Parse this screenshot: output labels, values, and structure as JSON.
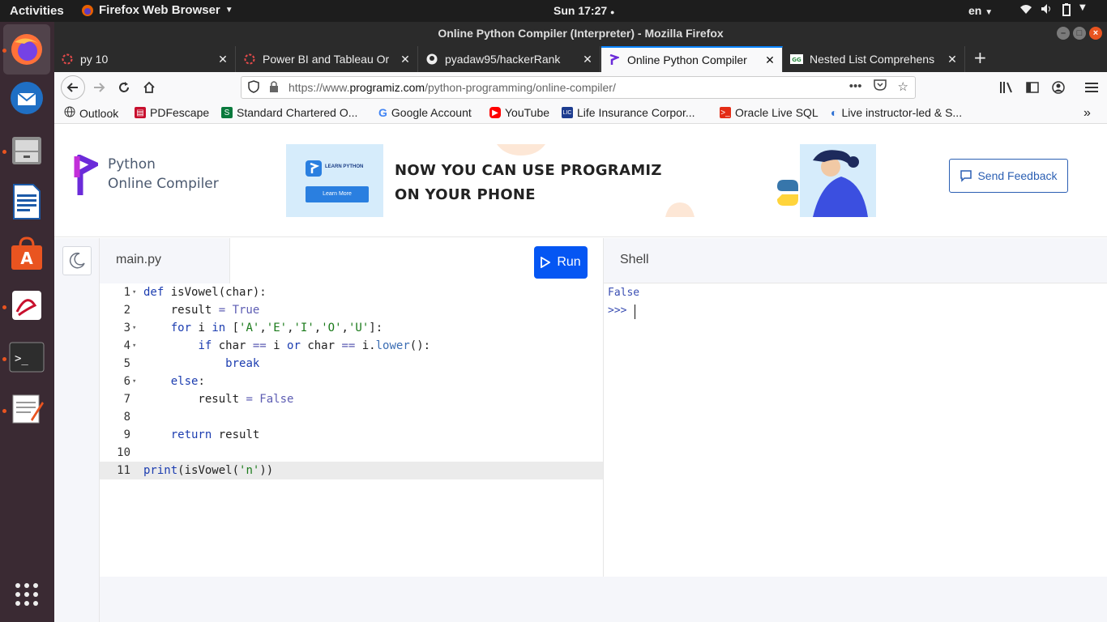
{
  "system": {
    "activities": "Activities",
    "app_name": "Firefox Web Browser",
    "clock": "Sun 17:27",
    "language": "en"
  },
  "window": {
    "title": "Online Python Compiler (Interpreter) - Mozilla Firefox"
  },
  "tabs": [
    {
      "label": "py 10"
    },
    {
      "label": "Power BI and Tableau Or"
    },
    {
      "label": "pyadaw95/hackerRank"
    },
    {
      "label": "Online Python Compiler"
    },
    {
      "label": "Nested List Comprehens"
    }
  ],
  "navbar": {
    "url_prefix": "https://www.",
    "url_domain": "programiz.com",
    "url_path": "/python-programming/online-compiler/"
  },
  "bookmarks": [
    {
      "label": "Outlook"
    },
    {
      "label": "PDFescape"
    },
    {
      "label": "Standard Chartered O..."
    },
    {
      "label": "Google Account"
    },
    {
      "label": "YouTube"
    },
    {
      "label": "Life Insurance Corpor..."
    },
    {
      "label": "Oracle Live SQL"
    },
    {
      "label": "Live instructor-led & S..."
    }
  ],
  "page": {
    "logo_line1": "Python",
    "logo_line2": "Online Compiler",
    "banner_learn": "LEARN PYTHON",
    "banner_learn_more": "Learn More",
    "banner_line1": "NOW YOU CAN USE PROGRAMIZ",
    "banner_line2": "ON YOUR PHONE",
    "feedback_label": "Send Feedback",
    "file_tab": "main.py",
    "run_label": "Run",
    "shell_label": "Shell"
  },
  "code_lines": [
    "1",
    "2",
    "3",
    "4",
    "5",
    "6",
    "7",
    "8",
    "9",
    "10",
    "11"
  ],
  "shell": {
    "output": "False",
    "prompt": ">>>"
  },
  "colors": {
    "run_button": "#0556f3",
    "accent_orange": "#e95420",
    "logo_purple": "#6b2bd9"
  }
}
